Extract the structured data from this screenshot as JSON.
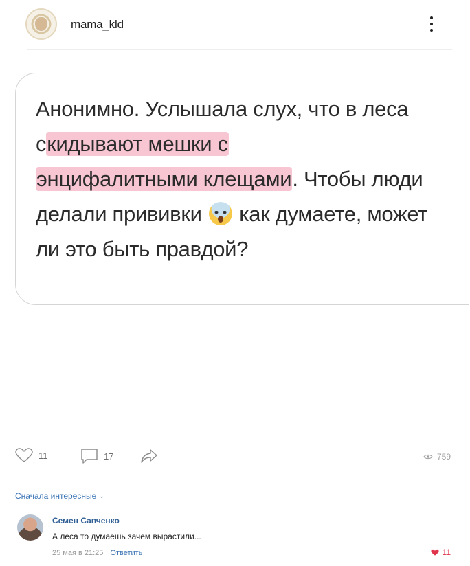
{
  "post": {
    "author": "mama_kld",
    "text_parts": {
      "p1": "Анонимно. Услышала слух, что в леса с",
      "p2": "кидывают мешки с",
      "p3": "энцифалитными клещами",
      "p4": ". Чтобы люди делали прививки ",
      "p5": " как думаете, может ли это быть правдой?"
    },
    "emoji": "😱"
  },
  "actions": {
    "likes": "11",
    "comments": "17",
    "views": "759"
  },
  "comments": {
    "sort_label": "Сначала интересные",
    "items": [
      {
        "name": "Семен Савченко",
        "text": "А леса то думаешь зачем вырастили...",
        "time": "25 мая в 21:25",
        "reply": "Ответить",
        "likes": "11"
      }
    ]
  },
  "colors": {
    "highlight": "#f7c6d2",
    "link": "#3a73b5",
    "like_active": "#e0334c"
  }
}
